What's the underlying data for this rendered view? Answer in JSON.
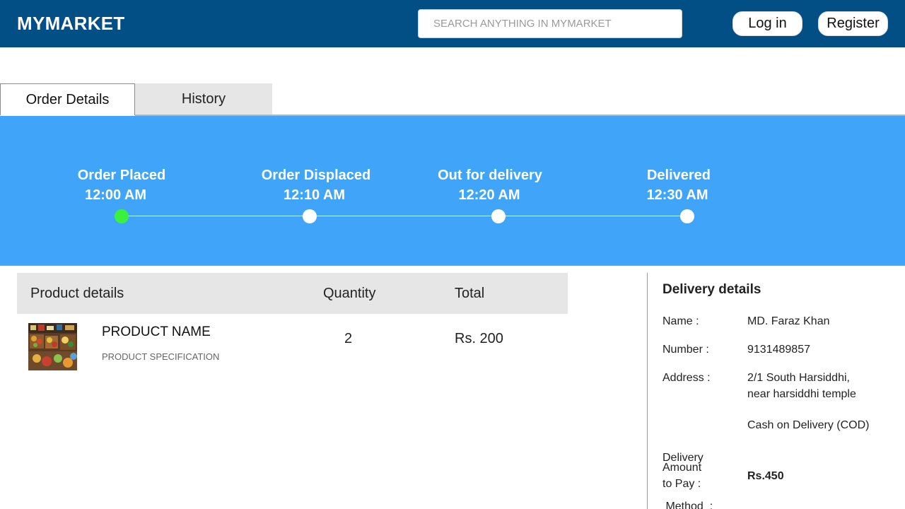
{
  "header": {
    "brand": "MYMARKET",
    "search_placeholder": "SEARCH ANYTHING IN MYMARKET",
    "login_label": "Log in",
    "register_label": "Register"
  },
  "tabs": [
    {
      "label": "Order Details",
      "active": true
    },
    {
      "label": "History",
      "active": false
    }
  ],
  "tracker": {
    "steps": [
      {
        "label": "Order Placed",
        "time": "12:00 AM",
        "completed": true
      },
      {
        "label": "Order Displaced",
        "time": "12:10 AM",
        "completed": false
      },
      {
        "label": "Out for delivery",
        "time": "12:20 AM",
        "completed": false
      },
      {
        "label": "Delivered",
        "time": "12:30 AM",
        "completed": false
      }
    ]
  },
  "products": {
    "headers": {
      "product": "Product details",
      "quantity": "Quantity",
      "total": "Total"
    },
    "items": [
      {
        "name": "PRODUCT NAME",
        "spec": "PRODUCT SPECIFICATION",
        "quantity": "2",
        "total": "Rs. 200"
      }
    ]
  },
  "delivery": {
    "title": "Delivery details",
    "name_label": "Name :",
    "name_value": "MD. Faraz Khan",
    "number_label": "Number :",
    "number_value": "9131489857",
    "address_label": "Address :",
    "address_line1": "2/1 South Harsiddhi,",
    "address_line2": "near harsiddhi temple",
    "method_label_1": "Delivery",
    "method_label_2": " Method  :",
    "method_value": "Cash on Delivery (COD)",
    "amount_label_1": "Amount",
    "amount_label_2": "to Pay :",
    "amount_value": "Rs.450"
  },
  "colors": {
    "header_bg": "#024f86",
    "tracker_bg": "#40a5f8",
    "step_done": "#3af23e",
    "step_pending": "#ffffff",
    "tab_inactive_bg": "#e6e6e6"
  }
}
